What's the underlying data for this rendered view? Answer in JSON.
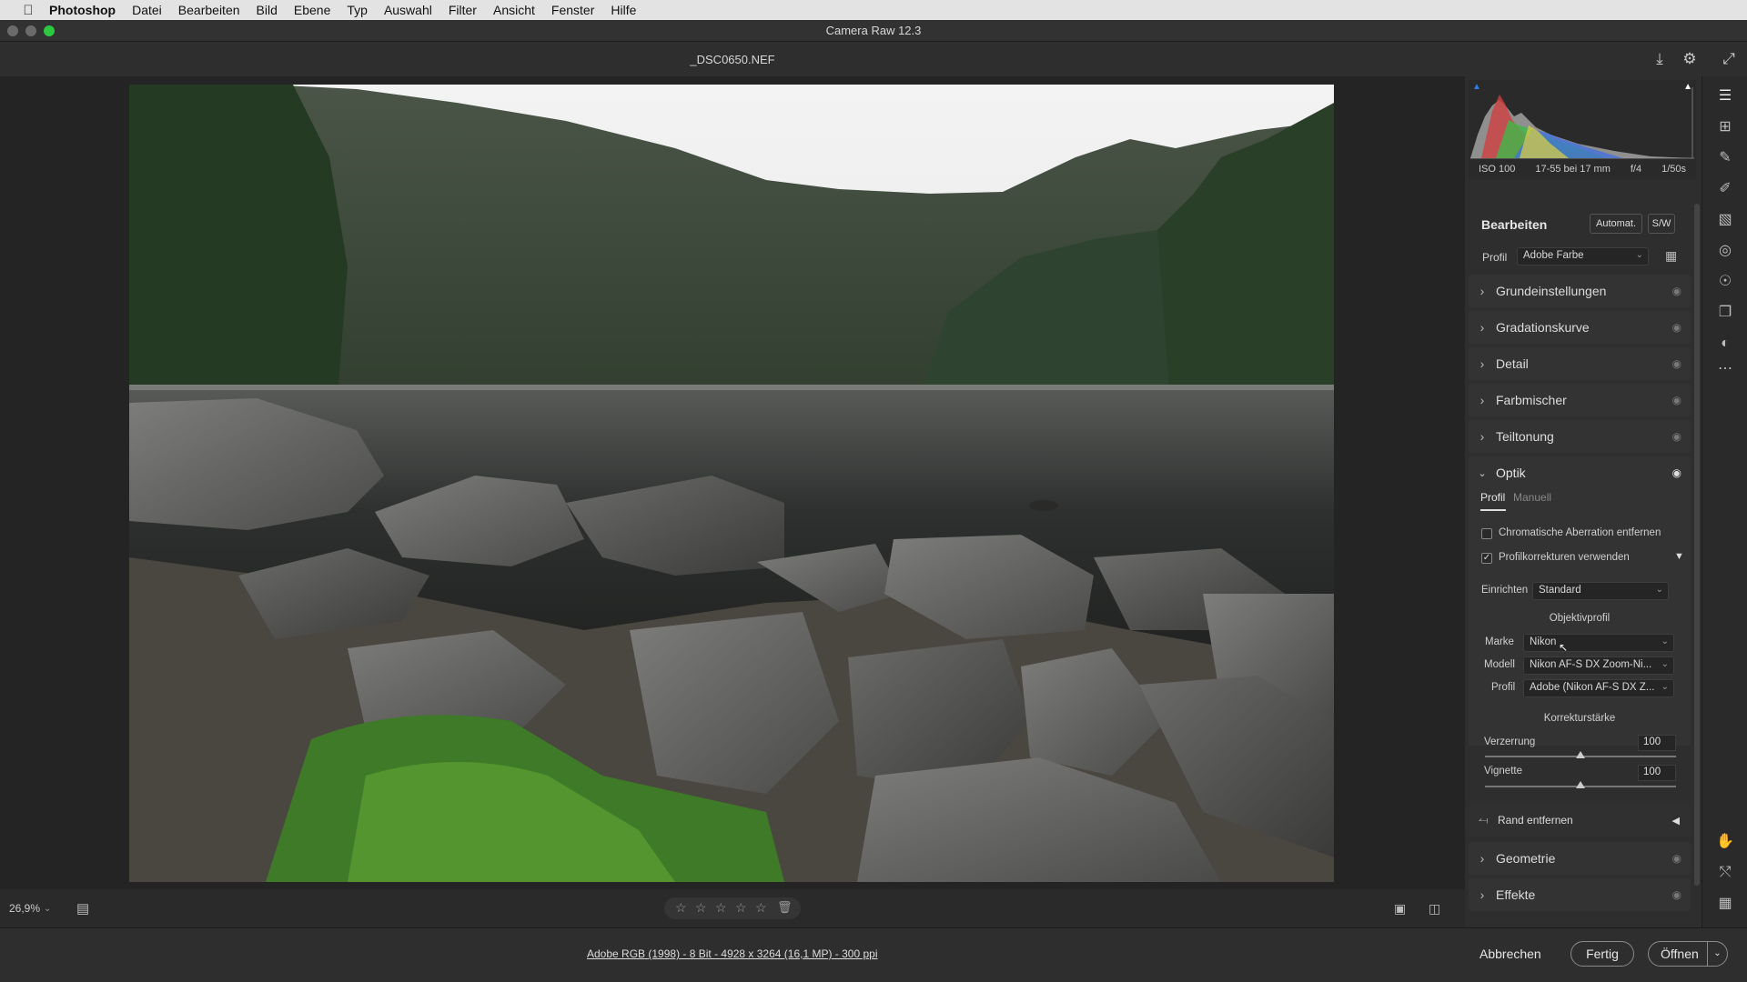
{
  "menubar": {
    "apple": "",
    "items": [
      "Photoshop",
      "Datei",
      "Bearbeiten",
      "Bild",
      "Ebene",
      "Typ",
      "Auswahl",
      "Filter",
      "Ansicht",
      "Fenster",
      "Hilfe"
    ]
  },
  "window": {
    "title": "Camera Raw 12.3",
    "filename": "_DSC0650.NEF"
  },
  "histogram": {
    "iso": "ISO 100",
    "lens": "17-55 bei 17 mm",
    "aperture": "f/4",
    "shutter": "1/50s"
  },
  "edit": {
    "heading": "Bearbeiten",
    "auto": "Automat.",
    "bw": "S/W",
    "profile_label": "Profil",
    "profile_value": "Adobe Farbe"
  },
  "sections": [
    "Grundeinstellungen",
    "Gradationskurve",
    "Detail",
    "Farbmischer",
    "Teiltonung"
  ],
  "optik": {
    "title": "Optik",
    "tab_profile": "Profil",
    "tab_manual": "Manuell",
    "chrom": "Chromatische Aberration entfernen",
    "profcorr": "Profilkorrekturen verwenden",
    "setup_label": "Einrichten",
    "setup_value": "Standard",
    "lens_profile_heading": "Objektivprofil",
    "make_label": "Marke",
    "make_value": "Nikon",
    "model_label": "Modell",
    "model_value": "Nikon AF-S DX Zoom-Ni...",
    "profil_label": "Profil",
    "profil_value": "Adobe (Nikon AF-S DX Z...",
    "strength_heading": "Korrekturstärke",
    "distortion_label": "Verzerrung",
    "distortion_value": "100",
    "vignette_label": "Vignette",
    "vignette_value": "100",
    "fringe": "Rand entfernen"
  },
  "sections_bottom": [
    "Geometrie",
    "Effekte"
  ],
  "bottombar": {
    "zoom": "26,9%"
  },
  "footer": {
    "info": "Adobe RGB (1998) - 8 Bit - 4928 x 3264 (16,1 MP) - 300 ppi",
    "cancel": "Abbrechen",
    "done": "Fertig",
    "open": "Öffnen"
  }
}
